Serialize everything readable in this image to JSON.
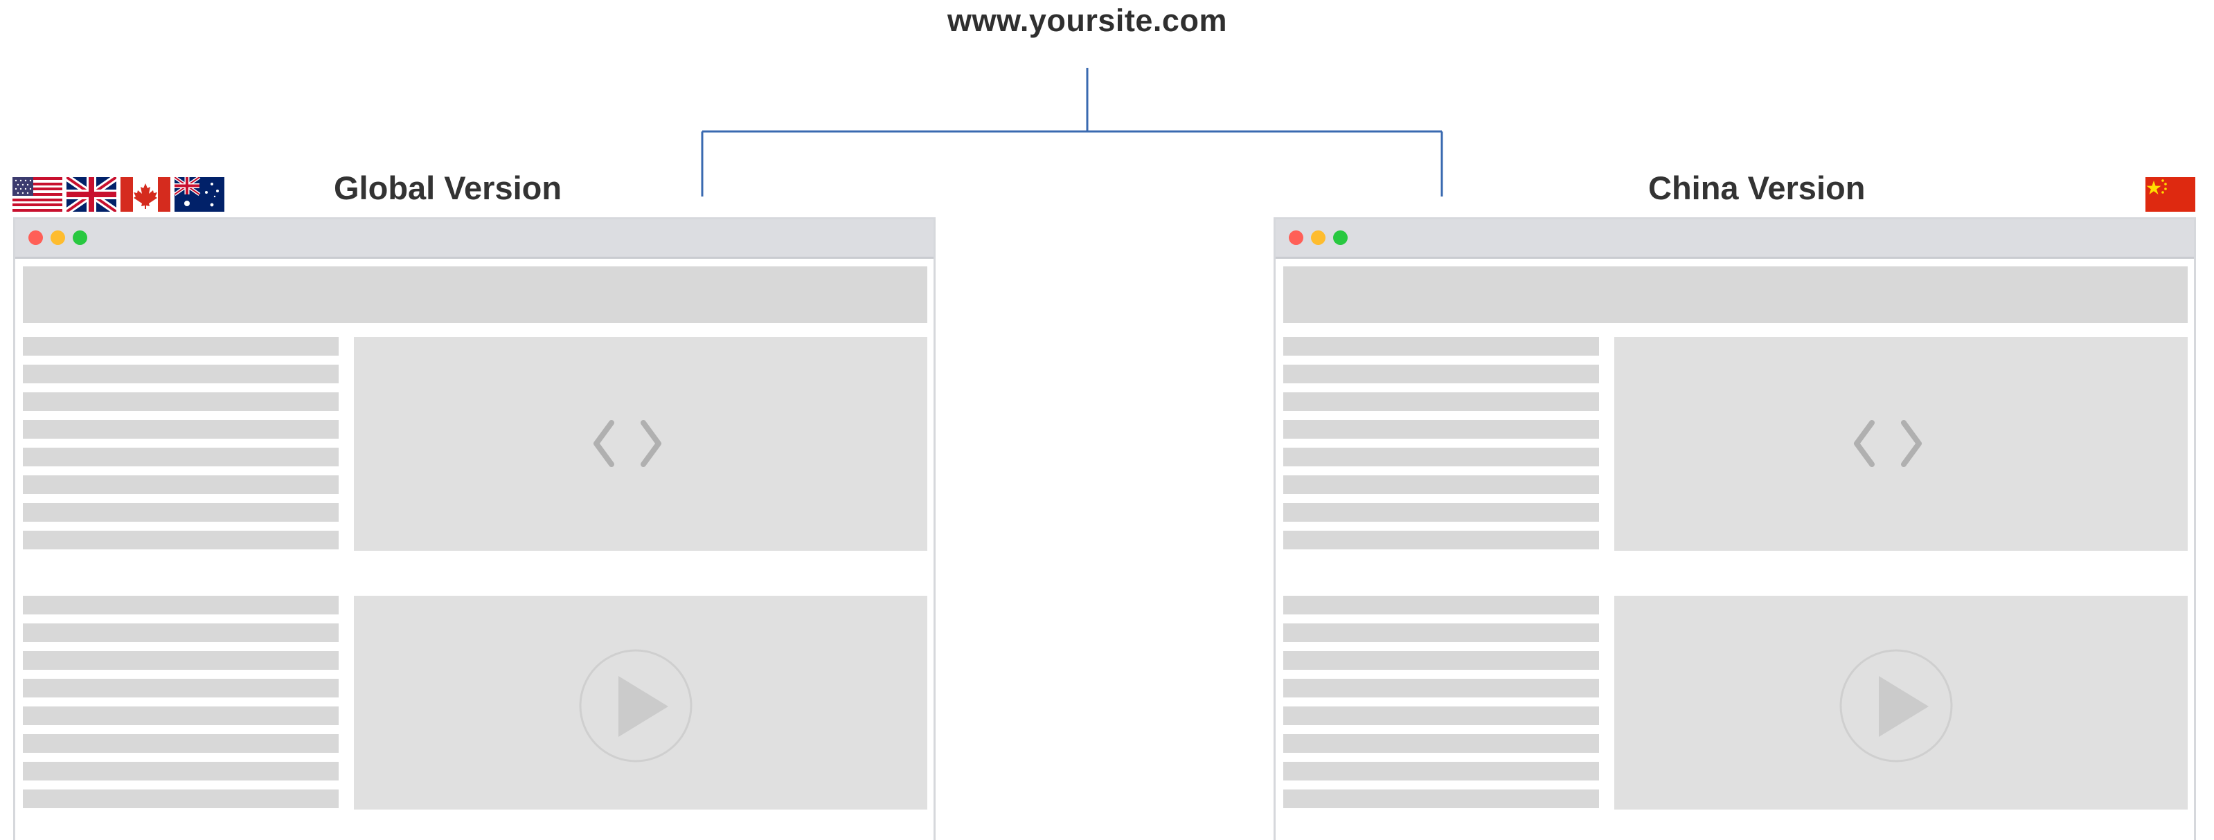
{
  "site": {
    "url": "www.yoursite.com"
  },
  "versions": {
    "global": {
      "title": "Global Version",
      "flags": [
        "us-flag-icon",
        "uk-flag-icon",
        "canada-flag-icon",
        "australia-flag-icon"
      ]
    },
    "china": {
      "title": "China Version",
      "flags": [
        "china-flag-icon"
      ]
    }
  },
  "colors": {
    "connector": "#3a6ab0",
    "placeholder": "#d8d8d8",
    "media_bg": "#e0e0e0",
    "titlebar": "#dcdde1",
    "window_close": "#ff5f57",
    "window_minimize": "#febc2e",
    "window_maximize": "#28c840"
  },
  "icons": {
    "code": "code-brackets-icon",
    "video": "play-icon"
  }
}
